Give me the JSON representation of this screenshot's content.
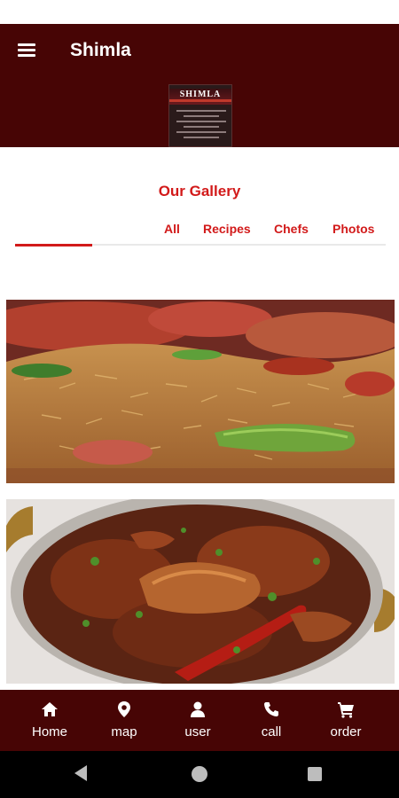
{
  "app": {
    "title": "Shimla"
  },
  "logo": {
    "brand_name": "SHIMLA"
  },
  "gallery": {
    "title": "Our Gallery",
    "tabs": [
      {
        "label": "All",
        "selected": true
      },
      {
        "label": "Recipes",
        "selected": false
      },
      {
        "label": "Chefs",
        "selected": false
      },
      {
        "label": "Photos",
        "selected": false
      }
    ],
    "photos": [
      {
        "icon": "biryani-rice-dish-photo"
      },
      {
        "icon": "chicken-curry-dish-photo"
      }
    ]
  },
  "bottom_nav": {
    "items": [
      {
        "label": "Home",
        "icon": "home-icon"
      },
      {
        "label": "map",
        "icon": "map-pin-icon"
      },
      {
        "label": "user",
        "icon": "user-icon"
      },
      {
        "label": "call",
        "icon": "phone-icon"
      },
      {
        "label": "order",
        "icon": "cart-icon"
      }
    ]
  },
  "colors": {
    "header_bg": "#470505",
    "accent": "#d21a1a",
    "nav_text": "#ffffff",
    "system_nav_bg": "#000000"
  }
}
